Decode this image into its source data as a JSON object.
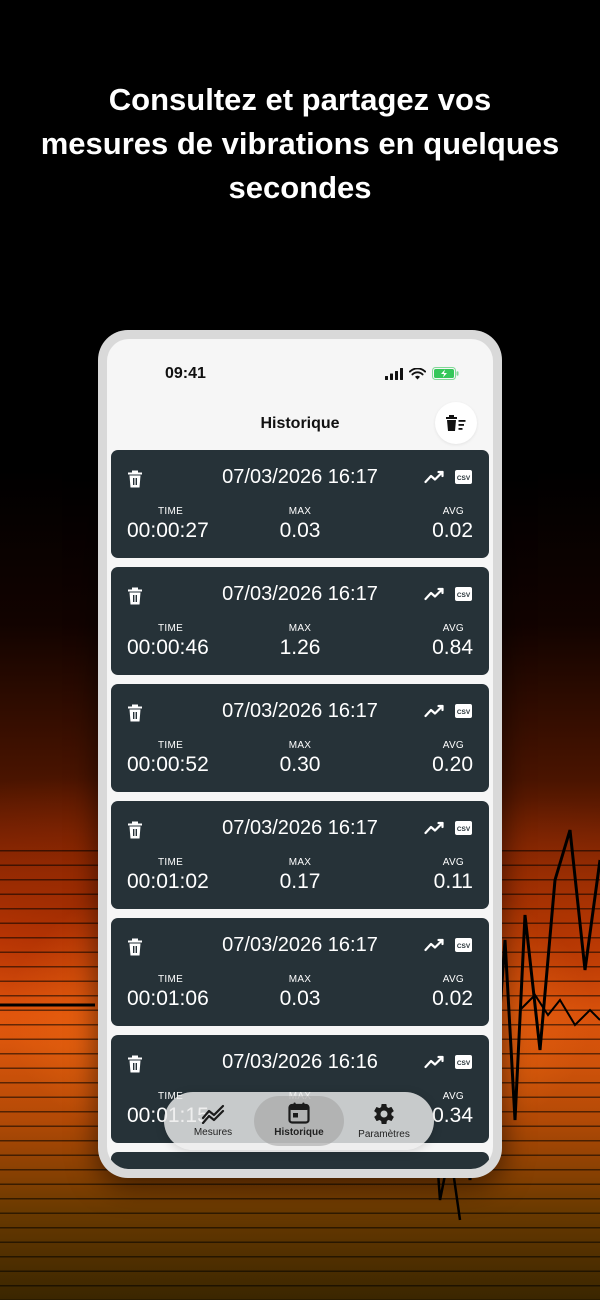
{
  "headline": {
    "line1": "Consultez et partagez vos",
    "line2": "mesures de vibrations en quelques",
    "line3": "secondes"
  },
  "status_bar": {
    "time": "09:41",
    "icons": [
      "cellular-signal-icon",
      "wifi-icon",
      "battery-charging-icon"
    ],
    "battery_color": "#34c759"
  },
  "nav": {
    "title": "Historique",
    "clear_icon": "trash-list-icon"
  },
  "labels": {
    "time": "TIME",
    "max": "MAX",
    "avg": "AVG",
    "csv": "CSV"
  },
  "records": [
    {
      "date": "07/03/2026 16:17",
      "time": "00:00:27",
      "max": "0.03",
      "avg": "0.02"
    },
    {
      "date": "07/03/2026 16:17",
      "time": "00:00:46",
      "max": "1.26",
      "avg": "0.84"
    },
    {
      "date": "07/03/2026 16:17",
      "time": "00:00:52",
      "max": "0.30",
      "avg": "0.20"
    },
    {
      "date": "07/03/2026 16:17",
      "time": "00:01:02",
      "max": "0.17",
      "avg": "0.11"
    },
    {
      "date": "07/03/2026 16:17",
      "time": "00:01:06",
      "max": "0.03",
      "avg": "0.02"
    },
    {
      "date": "07/03/2026 16:16",
      "time": "00:01:15",
      "max": "",
      "avg": "0.34"
    }
  ],
  "tabbar": {
    "tabs": [
      {
        "label": "Mesures",
        "icon": "chart-line-icon"
      },
      {
        "label": "Historique",
        "icon": "calendar-icon",
        "active": true
      },
      {
        "label": "Paramètres",
        "icon": "gear-icon"
      }
    ]
  },
  "colors": {
    "card_bg": "#263238",
    "screen_bg": "#f6f6f6",
    "accent_orange": "#e85a0e"
  }
}
